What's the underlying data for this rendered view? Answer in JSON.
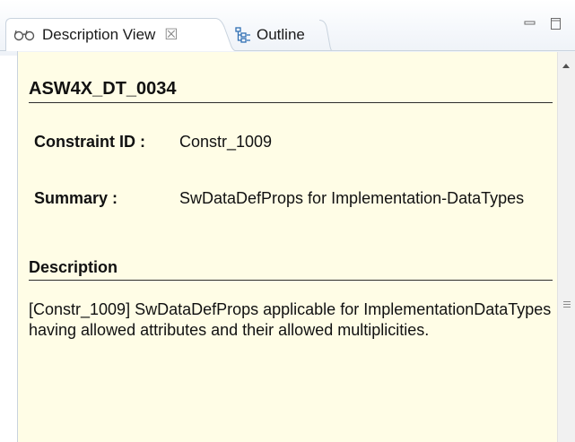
{
  "tabs": [
    {
      "label": "Description View",
      "icon": "glasses-icon",
      "close": "☒"
    },
    {
      "label": "Outline",
      "icon": "outline-icon"
    }
  ],
  "window_controls": {
    "minimize": "minimize-icon",
    "maximize": "maximize-icon"
  },
  "content": {
    "title": "ASW4X_DT_0034",
    "constraint_id_label": "Constraint ID :",
    "constraint_id_value": "Constr_1009",
    "summary_label": "Summary :",
    "summary_value": "SwDataDefProps for Implementation-DataTypes",
    "description_heading": "Description",
    "description_text": "[Constr_1009] SwDataDefProps applicable for ImplementationDataTypes having allowed attributes and their allowed multiplicities."
  },
  "colors": {
    "content_background": "#fffde6",
    "tab_border": "#c9d3de",
    "outline_icon": "#2f6fb3"
  }
}
